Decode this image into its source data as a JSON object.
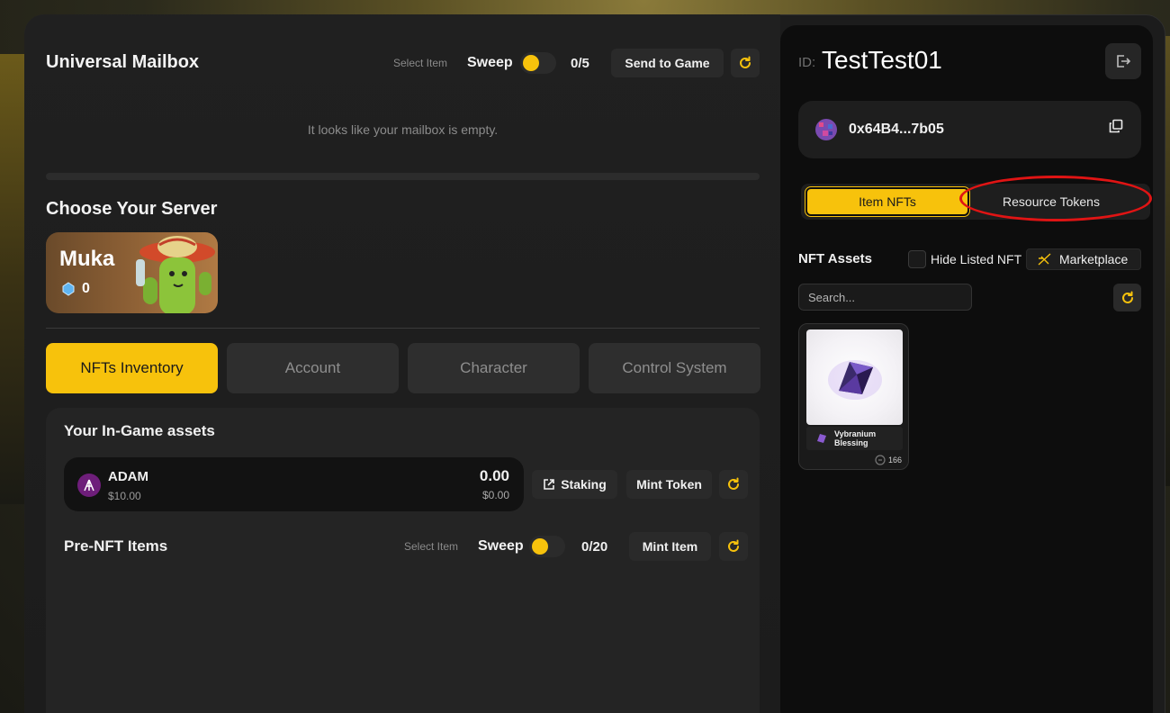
{
  "mailbox": {
    "title": "Universal Mailbox",
    "select_hint": "Select Item",
    "sweep_label": "Sweep",
    "count": "0/5",
    "send_label": "Send to Game",
    "empty_message": "It looks like your mailbox is empty."
  },
  "server": {
    "heading": "Choose Your Server",
    "name": "Muka",
    "count": "0"
  },
  "tabs": [
    {
      "label": "NFTs Inventory",
      "active": true
    },
    {
      "label": "Account",
      "active": false
    },
    {
      "label": "Character",
      "active": false
    },
    {
      "label": "Control System",
      "active": false
    }
  ],
  "assets": {
    "heading": "Your In-Game assets",
    "token": {
      "name": "ADAM",
      "price": "$10.00",
      "amount": "0.00",
      "value": "$0.00"
    },
    "staking_label": "Staking",
    "mint_token_label": "Mint Token"
  },
  "pre_nft": {
    "heading": "Pre-NFT Items",
    "select_hint": "Select Item",
    "sweep_label": "Sweep",
    "count": "0/20",
    "mint_item_label": "Mint Item"
  },
  "account": {
    "id_label": "ID:",
    "id_value": "TestTest01",
    "wallet": "0x64B4...7b05"
  },
  "segments": {
    "item_nfts": "Item NFTs",
    "resource_tokens": "Resource Tokens"
  },
  "nft_panel": {
    "heading": "NFT Assets",
    "hide_listed": "Hide Listed NFT",
    "marketplace": "Marketplace",
    "search_placeholder": "Search..."
  },
  "nft_items": [
    {
      "name": "Vybranium Blessing",
      "quantity": "166"
    }
  ],
  "colors": {
    "accent": "#f7c20c",
    "panel": "#242424",
    "annotation_ring": "#e01414"
  }
}
